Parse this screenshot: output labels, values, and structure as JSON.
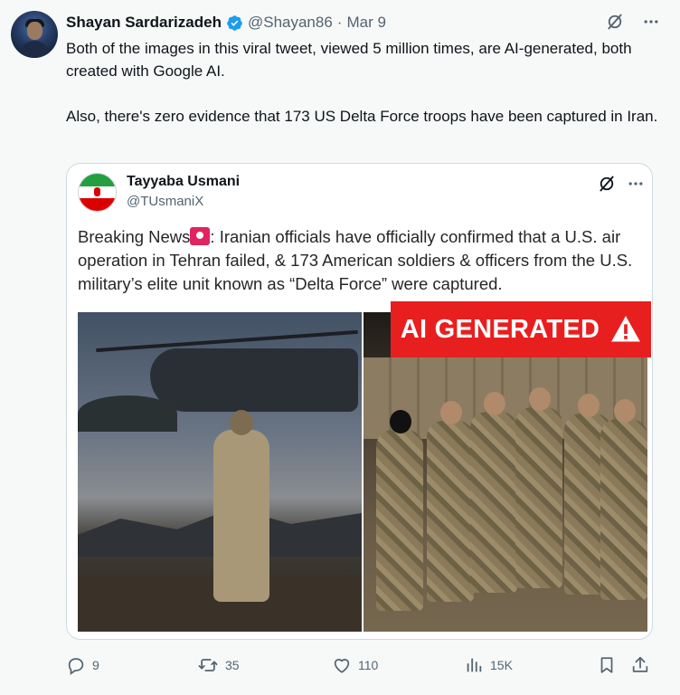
{
  "author": {
    "name": "Shayan Sardarizadeh",
    "handle": "@Shayan86",
    "separator": "·",
    "date": "Mar 9"
  },
  "tweet": {
    "paragraph_1": "Both of the images in this viral tweet, viewed 5 million times, are AI-generated, both created with Google AI.",
    "paragraph_2": "Also, there's zero evidence that 173 US Delta Force troops have been captured in Iran."
  },
  "quoted": {
    "name": "Tayyaba Usmani",
    "handle": "@TUsmaniX",
    "text_lead": "Breaking News",
    "text_rest": ": Iranian officials have officially confirmed that a U.S. air operation in Tehran failed, & 173 American soldiers & officers from the U.S. military’s elite unit known as “Delta Force” were captured.",
    "badge_label": "AI GENERATED",
    "flag_colors": {
      "green": "#239f40",
      "white": "#ffffff",
      "red": "#da0000"
    }
  },
  "actions": {
    "replies": "9",
    "reposts": "35",
    "likes": "110",
    "views": "15K"
  },
  "colors": {
    "text_primary": "#0f1419",
    "text_secondary": "#536471",
    "verified_blue": "#1d9bf0",
    "badge_red": "#e81f1f",
    "background": "#f7f9f9"
  },
  "icons": {
    "grok": "grok-icon",
    "more": "more-icon",
    "reply": "reply-icon",
    "repost": "repost-icon",
    "like": "like-icon",
    "views": "views-icon",
    "bookmark": "bookmark-icon",
    "share": "share-icon"
  }
}
